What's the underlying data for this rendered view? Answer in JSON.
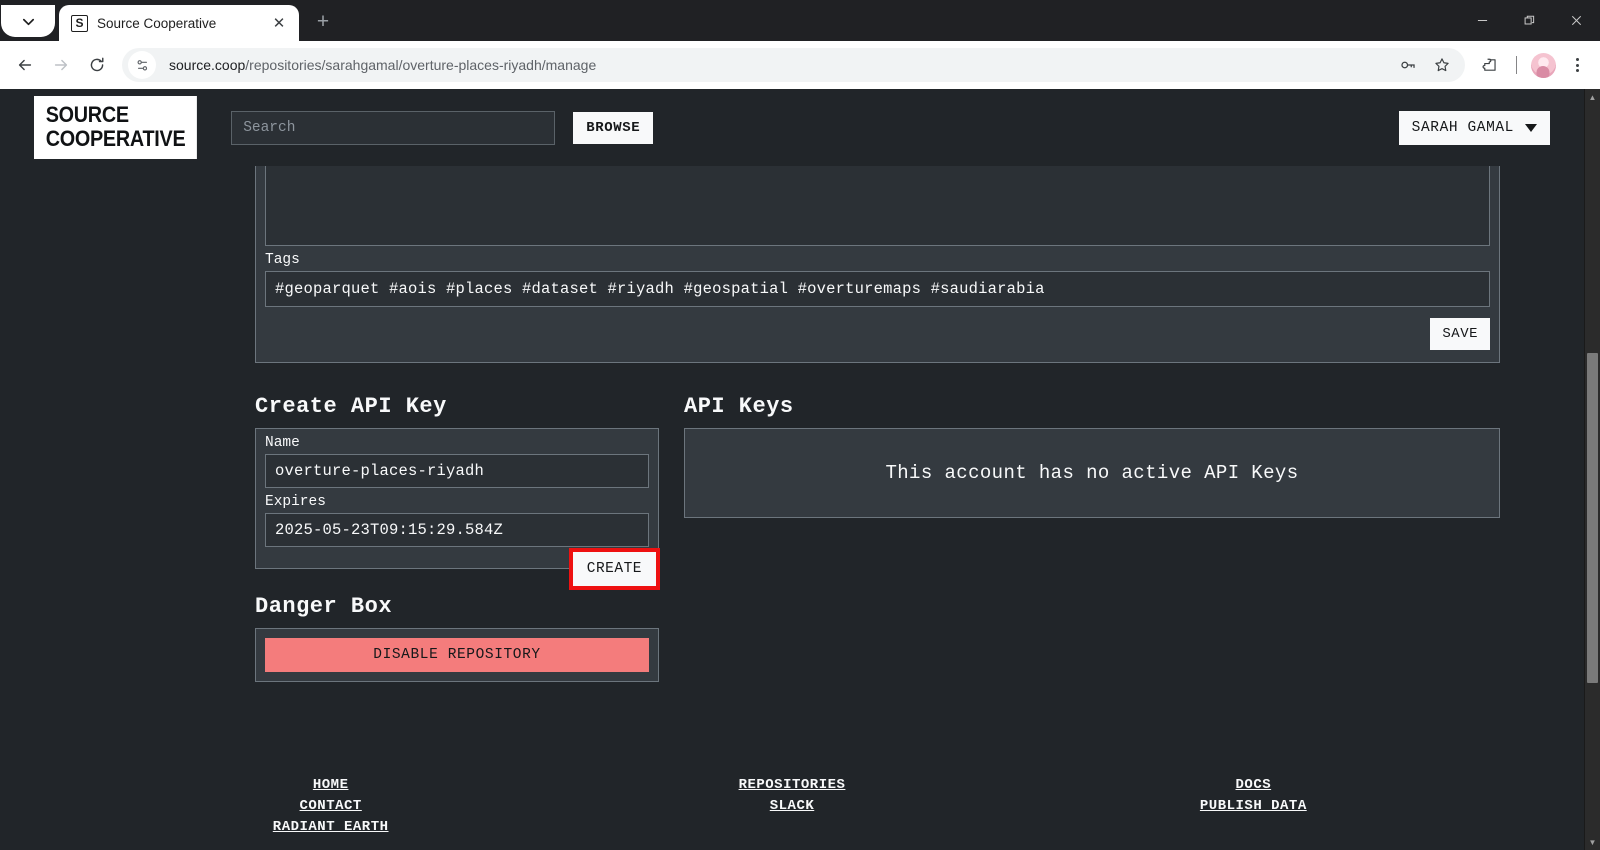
{
  "browser": {
    "tab": {
      "title": "Source Cooperative",
      "favicon_letter": "S"
    },
    "new_tab_label": "+",
    "url_domain": "source.coop",
    "url_path": "/repositories/sarahgamal/overture-places-riyadh/manage",
    "window": {
      "minimize": "minimize-icon",
      "restore": "restore-icon",
      "close": "close-icon"
    },
    "toolbar_icons": [
      "back-icon",
      "forward-icon",
      "reload-icon",
      "site-settings-icon",
      "password-key-icon",
      "bookmark-star-icon",
      "extensions-puzzle-icon",
      "profile-avatar",
      "browser-menu-icon"
    ]
  },
  "header": {
    "logo_line1": "SOURCE",
    "logo_line2": "COOPERATIVE",
    "search_placeholder": "Search",
    "search_value": "",
    "browse_label": "BROWSE",
    "user_name": "SARAH GAMAL"
  },
  "edit_panel": {
    "tags_label": "Tags",
    "tags_value": "#geoparquet #aois #places #dataset #riyadh #geospatial #overturemaps #saudiarabia",
    "save_label": "SAVE"
  },
  "create_api_key": {
    "title": "Create API Key",
    "name_label": "Name",
    "name_value": "overture-places-riyadh",
    "expires_label": "Expires",
    "expires_value": "2025-05-23T09:15:29.584Z",
    "create_label": "CREATE",
    "highlight_color": "#ee1111"
  },
  "api_keys": {
    "title": "API Keys",
    "empty_message": "This account has no active API Keys"
  },
  "danger_box": {
    "title": "Danger Box",
    "disable_label": "DISABLE REPOSITORY",
    "button_color": "#f47c7c"
  },
  "footer": {
    "col1": [
      "HOME",
      "CONTACT",
      "RADIANT EARTH"
    ],
    "col2": [
      "REPOSITORIES",
      "SLACK"
    ],
    "col3": [
      "DOCS",
      "PUBLISH DATA"
    ]
  },
  "theme": {
    "page_bg": "#212529",
    "panel_bg": "#343a40",
    "input_bg": "#2b3035",
    "border": "#6c757d",
    "text": "#f8f9fa"
  }
}
